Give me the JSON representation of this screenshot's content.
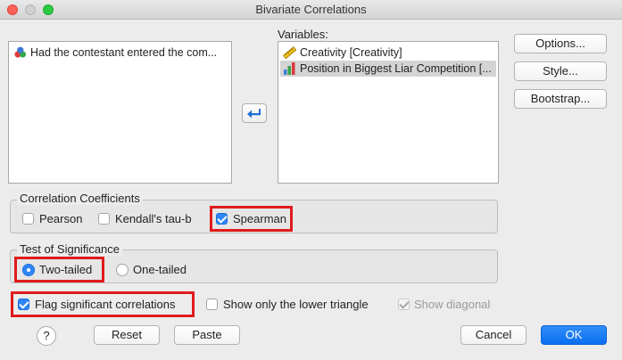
{
  "window": {
    "title": "Bivariate Correlations"
  },
  "source_list": {
    "items": [
      {
        "label": "Had the contestant entered the com...",
        "icon": "nominal-variable-icon"
      }
    ]
  },
  "variables": {
    "label": "Variables:",
    "items": [
      {
        "label": "Creativity [Creativity]",
        "icon": "scale-ruler-icon",
        "selected": false
      },
      {
        "label": "Position in Biggest Liar Competition [...",
        "icon": "ordinal-bars-icon",
        "selected": true
      }
    ]
  },
  "side_buttons": {
    "options": "Options...",
    "style": "Style...",
    "bootstrap": "Bootstrap..."
  },
  "coefficients": {
    "title": "Correlation Coefficients",
    "pearson": "Pearson",
    "kendall": "Kendall's tau-b",
    "spearman": "Spearman",
    "checked": {
      "pearson": false,
      "kendall": false,
      "spearman": true
    }
  },
  "significance": {
    "title": "Test of Significance",
    "two_tailed": "Two-tailed",
    "one_tailed": "One-tailed",
    "selected": "two_tailed"
  },
  "options_row": {
    "flag": "Flag significant correlations",
    "lower": "Show only the lower triangle",
    "diagonal": "Show diagonal"
  },
  "footer": {
    "help": "?",
    "reset": "Reset",
    "paste": "Paste",
    "cancel": "Cancel",
    "ok": "OK"
  },
  "colors": {
    "highlight": "#e01b1b",
    "accent": "#2f85f5"
  }
}
